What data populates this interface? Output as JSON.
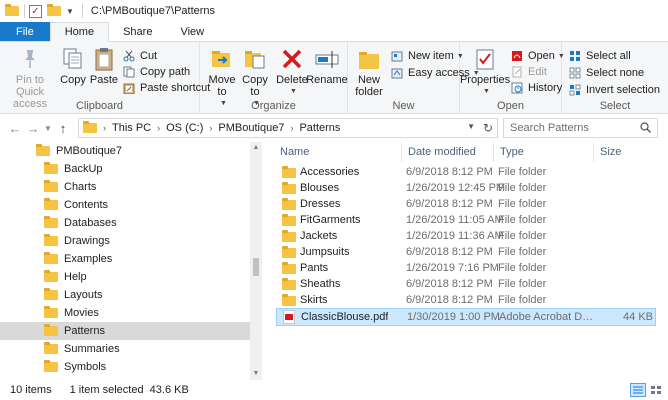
{
  "window": {
    "title": "C:\\PMBoutique7\\Patterns"
  },
  "tabs": [
    {
      "label": "File"
    },
    {
      "label": "Home"
    },
    {
      "label": "Share"
    },
    {
      "label": "View"
    }
  ],
  "ribbon": {
    "clipboard": {
      "label": "Clipboard",
      "pin": "Pin to Quick access",
      "copy": "Copy",
      "paste": "Paste",
      "cut": "Cut",
      "copy_path": "Copy path",
      "paste_shortcut": "Paste shortcut"
    },
    "organize": {
      "label": "Organize",
      "move_to": "Move to",
      "copy_to": "Copy to",
      "delete": "Delete",
      "rename": "Rename"
    },
    "new": {
      "label": "New",
      "new_folder": "New folder",
      "new_item": "New item",
      "easy_access": "Easy access"
    },
    "open": {
      "label": "Open",
      "properties": "Properties",
      "open": "Open",
      "edit": "Edit",
      "history": "History"
    },
    "select": {
      "label": "Select",
      "select_all": "Select all",
      "select_none": "Select none",
      "invert_selection": "Invert selection"
    }
  },
  "address": {
    "crumbs": [
      "This PC",
      "OS (C:)",
      "PMBoutique7",
      "Patterns"
    ],
    "search_placeholder": "Search Patterns"
  },
  "nav": {
    "root": "PMBoutique7",
    "items": [
      {
        "label": "BackUp"
      },
      {
        "label": "Charts"
      },
      {
        "label": "Contents"
      },
      {
        "label": "Databases"
      },
      {
        "label": "Drawings"
      },
      {
        "label": "Examples"
      },
      {
        "label": "Help"
      },
      {
        "label": "Layouts"
      },
      {
        "label": "Movies"
      },
      {
        "label": "Patterns"
      },
      {
        "label": "Summaries"
      },
      {
        "label": "Symbols"
      }
    ],
    "selected": "Patterns"
  },
  "files": {
    "columns": {
      "name": "Name",
      "date": "Date modified",
      "type": "Type",
      "size": "Size"
    },
    "rows": [
      {
        "name": "Accessories",
        "date": "6/9/2018 8:12 PM",
        "type": "File folder",
        "size": "",
        "kind": "folder"
      },
      {
        "name": "Blouses",
        "date": "1/26/2019 12:45 PM",
        "type": "File folder",
        "size": "",
        "kind": "folder"
      },
      {
        "name": "Dresses",
        "date": "6/9/2018 8:12 PM",
        "type": "File folder",
        "size": "",
        "kind": "folder"
      },
      {
        "name": "FitGarments",
        "date": "1/26/2019 11:05 AM",
        "type": "File folder",
        "size": "",
        "kind": "folder"
      },
      {
        "name": "Jackets",
        "date": "1/26/2019 11:36 AM",
        "type": "File folder",
        "size": "",
        "kind": "folder"
      },
      {
        "name": "Jumpsuits",
        "date": "6/9/2018 8:12 PM",
        "type": "File folder",
        "size": "",
        "kind": "folder"
      },
      {
        "name": "Pants",
        "date": "1/26/2019 7:16 PM",
        "type": "File folder",
        "size": "",
        "kind": "folder"
      },
      {
        "name": "Sheaths",
        "date": "6/9/2018 8:12 PM",
        "type": "File folder",
        "size": "",
        "kind": "folder"
      },
      {
        "name": "Skirts",
        "date": "6/9/2018 8:12 PM",
        "type": "File folder",
        "size": "",
        "kind": "folder"
      },
      {
        "name": "ClassicBlouse.pdf",
        "date": "1/30/2019 1:00 PM",
        "type": "Adobe Acrobat Doc...",
        "size": "44 KB",
        "kind": "pdf"
      }
    ]
  },
  "status": {
    "count": "10 items",
    "selection": "1 item selected  43.6 KB"
  },
  "colors": {
    "file_tab": "#1979ca",
    "folder": "#f6c445",
    "selection": "#cce8ff",
    "pdf": "#d6191b"
  }
}
